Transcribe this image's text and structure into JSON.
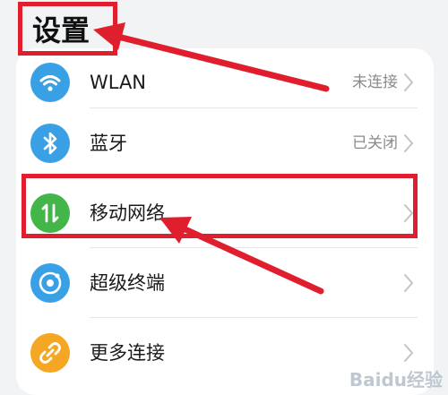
{
  "header": {
    "title": "设置"
  },
  "settings": {
    "items": [
      {
        "label": "WLAN",
        "status": "未连接",
        "icon": "wifi-icon",
        "icon_color": "#3aa0e6"
      },
      {
        "label": "蓝牙",
        "status": "已关闭",
        "icon": "bluetooth-icon",
        "icon_color": "#3aa0e6"
      },
      {
        "label": "移动网络",
        "status": "",
        "icon": "mobile-data-icon",
        "icon_color": "#44b549"
      },
      {
        "label": "超级终端",
        "status": "",
        "icon": "super-device-icon",
        "icon_color": "#3aa0e6"
      },
      {
        "label": "更多连接",
        "status": "",
        "icon": "link-icon",
        "icon_color": "#f5a623"
      }
    ]
  },
  "annotations": {
    "highlight_color": "#e01f2e"
  },
  "watermark": {
    "text": "Baidu经验"
  }
}
